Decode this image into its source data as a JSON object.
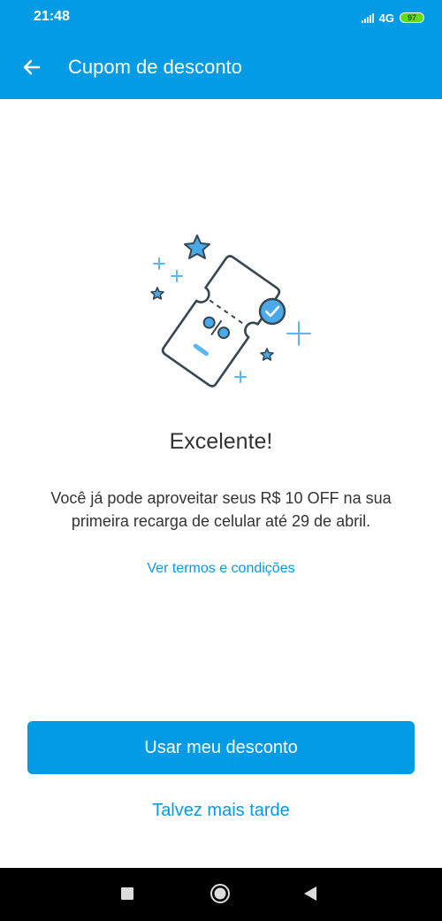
{
  "status_bar": {
    "time": "21:48",
    "network": "4G",
    "battery": "97",
    "icons": [
      "signal-icon",
      "battery-icon"
    ]
  },
  "app_bar": {
    "title": "Cupom de desconto",
    "back_icon": "arrow-back-icon"
  },
  "illustration": {
    "icon": "coupon-ticket-check-icon"
  },
  "content": {
    "heading": "Excelente!",
    "message": "Você já pode aproveitar seus R$ 10 OFF na sua primeira recarga de celular até 29 de abril.",
    "terms_link": "Ver termos e condições"
  },
  "actions": {
    "primary": "Usar meu desconto",
    "secondary": "Talvez mais tarde"
  },
  "nav_bar": {
    "icons": [
      "recents-icon",
      "home-icon",
      "back-icon"
    ]
  },
  "colors": {
    "primary": "#039be5",
    "text": "#333333",
    "battery": "#64dd17"
  }
}
